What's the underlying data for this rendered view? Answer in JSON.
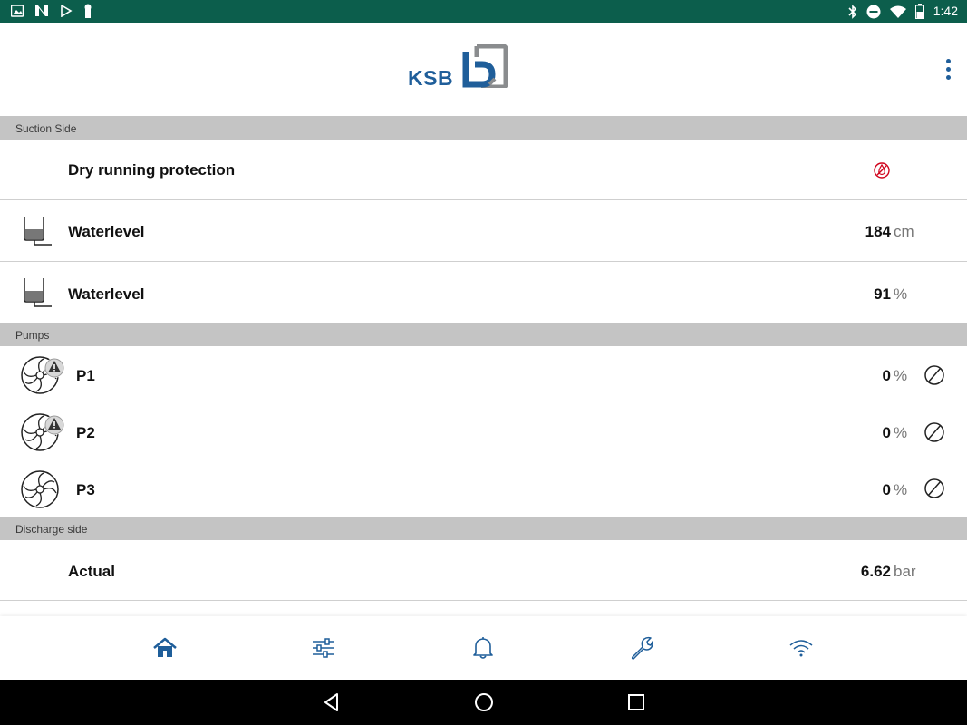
{
  "status_bar": {
    "time": "1:42",
    "left_icons": [
      "image-icon",
      "n-icon",
      "play-store-icon",
      "usb-icon"
    ],
    "right_icons": [
      "bluetooth-icon",
      "do-not-disturb-icon",
      "wifi-icon",
      "battery-icon"
    ]
  },
  "header": {
    "logo_text": "KSB",
    "menu_icon": "more-vert-icon"
  },
  "sections": {
    "suction": "Suction Side",
    "pumps": "Pumps",
    "discharge": "Discharge side"
  },
  "suction_rows": {
    "dry_run": {
      "label": "Dry running protection",
      "status_icon": "dry-run-off-icon"
    },
    "waterlevel_cm": {
      "label": "Waterlevel",
      "value": "184",
      "unit": "cm"
    },
    "waterlevel_pct": {
      "label": "Waterlevel",
      "value": "91",
      "unit": "%"
    }
  },
  "pumps": [
    {
      "label": "P1",
      "value": "0",
      "unit": "%",
      "warning": true
    },
    {
      "label": "P2",
      "value": "0",
      "unit": "%",
      "warning": true
    },
    {
      "label": "P3",
      "value": "0",
      "unit": "%",
      "warning": false
    }
  ],
  "discharge_rows": {
    "actual": {
      "label": "Actual",
      "value": "6.62",
      "unit": "bar"
    }
  },
  "bottom_nav": [
    "home-icon",
    "settings-sliders-icon",
    "bell-icon",
    "wrench-icon",
    "wifi-icon"
  ],
  "colors": {
    "status_bar": "#0c5e4c",
    "brand_blue": "#1f5e9a",
    "section_bg": "#c4c4c4",
    "alert_red": "#d0021b"
  }
}
